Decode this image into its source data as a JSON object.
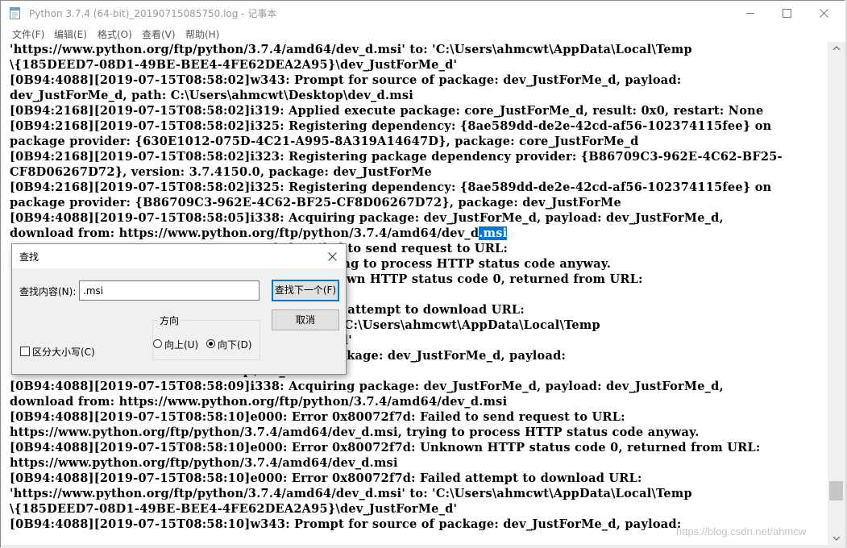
{
  "window": {
    "title": "Python 3.7.4 (64-bit)_20190715085750.log - 记事本"
  },
  "menu": [
    "文件(F)",
    "编辑(E)",
    "格式(O)",
    "查看(V)",
    "帮助(H)"
  ],
  "log_lines": [
    "'https://www.python.org/ftp/python/3.7.4/amd64/dev_d.msi' to: 'C:\\Users\\ahmcwt\\AppData\\Local\\Temp",
    "\\{185DEED7-08D1-49BE-BEE4-4FE62DEA2A95}\\dev_JustForMe_d'",
    "[0B94:4088][2019-07-15T08:58:02]w343: Prompt for source of package: dev_JustForMe_d, payload:",
    "dev_JustForMe_d, path: C:\\Users\\ahmcwt\\Desktop\\dev_d.msi",
    "[0B94:2168][2019-07-15T08:58:02]i319: Applied execute package: core_JustForMe_d, result: 0x0, restart: None",
    "[0B94:2168][2019-07-15T08:58:02]i325: Registering dependency: {8ae589dd-de2e-42cd-af56-102374115fee} on",
    "package provider: {630E1012-075D-4C21-A995-8A319A14647D}, package: core_JustForMe_d",
    "[0B94:2168][2019-07-15T08:58:02]i323: Registering package dependency provider: {B86709C3-962E-4C62-BF25-",
    "CF8D06267D72}, version: 3.7.4150.0, package: dev_JustForMe",
    "[0B94:2168][2019-07-15T08:58:02]i325: Registering dependency: {8ae589dd-de2e-42cd-af56-102374115fee} on",
    "package provider: {B86709C3-962E-4C62-BF25-CF8D06267D72}, package: dev_JustForMe",
    "[0B94:4088][2019-07-15T08:58:05]i338: Acquiring package: dev_JustForMe_d, payload: dev_JustForMe_d,",
    "download from: https://www.python.org/ftp/python/3.7.4/amd64/dev_d",
    "                                                0x80072f7d: Failed to send request to URL:",
    "                                                d64/dev_d.msi, trying to process HTTP status code anyway.",
    "                                                0x80072f7d: Unknown HTTP status code 0, returned from URL:",
    "                                                d64/dev_d.msi",
    "                                                0x80072f7d: Failed attempt to download URL:",
    "                                                d64/dev_d.msi' to: 'C:\\Users\\ahmcwt\\AppData\\Local\\Temp",
    "                                                5}\\dev_JustForMe_d'",
    "                                                pt for source of package: dev_JustForMe_d, payload:",
    "                                                sktop\\dev_d.msi",
    "[0B94:4088][2019-07-15T08:58:09]i338: Acquiring package: dev_JustForMe_d, payload: dev_JustForMe_d,",
    "download from: https://www.python.org/ftp/python/3.7.4/amd64/dev_d.msi",
    "[0B94:4088][2019-07-15T08:58:10]e000: Error 0x80072f7d: Failed to send request to URL:",
    "https://www.python.org/ftp/python/3.7.4/amd64/dev_d.msi, trying to process HTTP status code anyway.",
    "[0B94:4088][2019-07-15T08:58:10]e000: Error 0x80072f7d: Unknown HTTP status code 0, returned from URL:",
    "https://www.python.org/ftp/python/3.7.4/amd64/dev_d.msi",
    "[0B94:4088][2019-07-15T08:58:10]e000: Error 0x80072f7d: Failed attempt to download URL:",
    "'https://www.python.org/ftp/python/3.7.4/amd64/dev_d.msi' to: 'C:\\Users\\ahmcwt\\AppData\\Local\\Temp",
    "\\{185DEED7-08D1-49BE-BEE4-4FE62DEA2A95}\\dev_JustForMe_d'",
    "[0B94:4088][2019-07-15T08:58:10]w343: Prompt for source of package: dev_JustForMe_d, payload:"
  ],
  "selection": ".msi",
  "find_dialog": {
    "title": "查找",
    "find_label": "查找内容(N):",
    "find_value": ".msi",
    "find_next": "查找下一个(F)",
    "cancel": "取消",
    "direction_label": "方向",
    "up_label": "向上(U)",
    "down_label": "向下(D)",
    "direction_selected": "down",
    "match_case_label": "区分大小写(C)",
    "match_case_checked": false
  },
  "watermark": "https://blog.csdn.net/ahmcw"
}
